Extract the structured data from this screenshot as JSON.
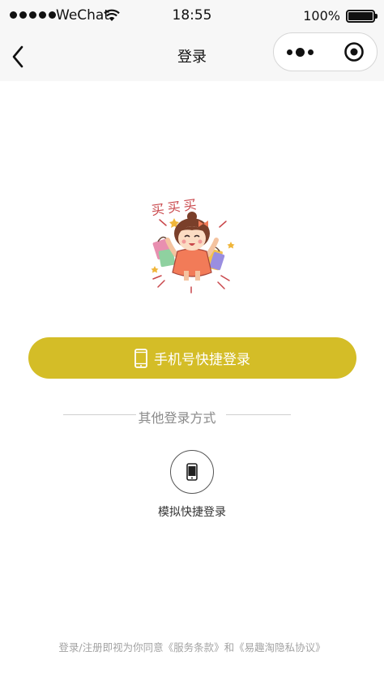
{
  "status_bar": {
    "carrier": "WeChat",
    "time": "18:55",
    "battery": "100%"
  },
  "nav": {
    "title": "登录",
    "icons": {
      "back": "chevron-left-icon",
      "more": "more-dots-icon",
      "close": "target-circle-icon"
    }
  },
  "main": {
    "mascot": "shopping-girl-illustration",
    "mascot_caption": "买买买",
    "phone_login_label": "手机号快捷登录",
    "other_methods_label": "其他登录方式",
    "simulate_login_label": "模拟快捷登录"
  },
  "agreement": {
    "prefix": "登录/注册即视为你同意",
    "terms": "《服务条款》",
    "and": "和",
    "privacy": "《易趣淘隐私协议》"
  },
  "colors": {
    "accent": "#d4bd27",
    "bar_background": "#f7f7f7",
    "muted_text": "#8a8a8a"
  }
}
